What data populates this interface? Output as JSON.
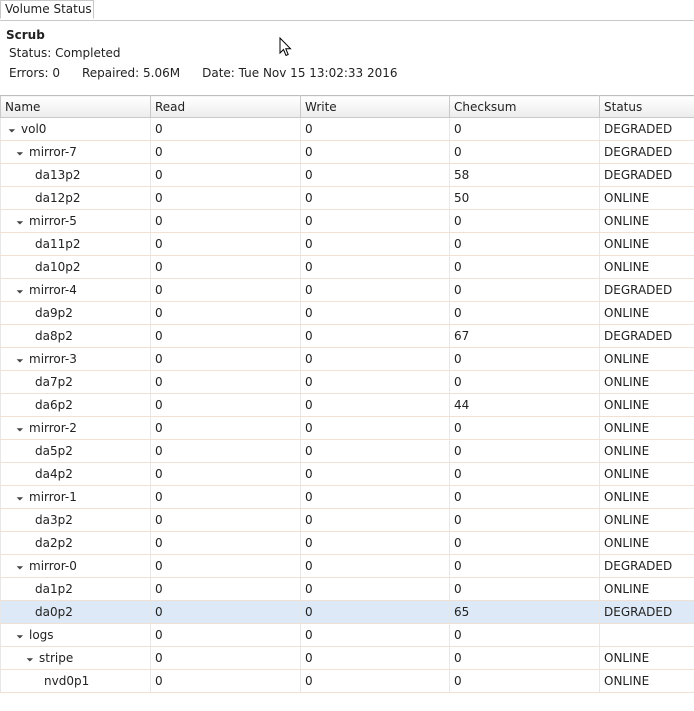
{
  "tab": {
    "label": "Volume Status"
  },
  "scrub": {
    "title": "Scrub",
    "status": "Status: Completed",
    "errors": "Errors: 0",
    "repaired": "Repaired: 5.06M",
    "date": "Date: Tue Nov 15 13:02:33 2016"
  },
  "table": {
    "columns": [
      "Name",
      "Read",
      "Write",
      "Checksum",
      "Status"
    ],
    "rows": [
      {
        "name": "vol0",
        "level": 0,
        "expander": true,
        "read": "0",
        "write": "0",
        "checksum": "0",
        "status": "DEGRADED"
      },
      {
        "name": "mirror-7",
        "level": 1,
        "expander": true,
        "read": "0",
        "write": "0",
        "checksum": "0",
        "status": "DEGRADED"
      },
      {
        "name": "da13p2",
        "level": 2,
        "expander": false,
        "read": "0",
        "write": "0",
        "checksum": "58",
        "status": "DEGRADED"
      },
      {
        "name": "da12p2",
        "level": 2,
        "expander": false,
        "read": "0",
        "write": "0",
        "checksum": "50",
        "status": "ONLINE"
      },
      {
        "name": "mirror-5",
        "level": 1,
        "expander": true,
        "read": "0",
        "write": "0",
        "checksum": "0",
        "status": "ONLINE"
      },
      {
        "name": "da11p2",
        "level": 2,
        "expander": false,
        "read": "0",
        "write": "0",
        "checksum": "0",
        "status": "ONLINE"
      },
      {
        "name": "da10p2",
        "level": 2,
        "expander": false,
        "read": "0",
        "write": "0",
        "checksum": "0",
        "status": "ONLINE"
      },
      {
        "name": "mirror-4",
        "level": 1,
        "expander": true,
        "read": "0",
        "write": "0",
        "checksum": "0",
        "status": "DEGRADED"
      },
      {
        "name": "da9p2",
        "level": 2,
        "expander": false,
        "read": "0",
        "write": "0",
        "checksum": "0",
        "status": "ONLINE"
      },
      {
        "name": "da8p2",
        "level": 2,
        "expander": false,
        "read": "0",
        "write": "0",
        "checksum": "67",
        "status": "DEGRADED"
      },
      {
        "name": "mirror-3",
        "level": 1,
        "expander": true,
        "read": "0",
        "write": "0",
        "checksum": "0",
        "status": "ONLINE"
      },
      {
        "name": "da7p2",
        "level": 2,
        "expander": false,
        "read": "0",
        "write": "0",
        "checksum": "0",
        "status": "ONLINE"
      },
      {
        "name": "da6p2",
        "level": 2,
        "expander": false,
        "read": "0",
        "write": "0",
        "checksum": "44",
        "status": "ONLINE"
      },
      {
        "name": "mirror-2",
        "level": 1,
        "expander": true,
        "read": "0",
        "write": "0",
        "checksum": "0",
        "status": "ONLINE"
      },
      {
        "name": "da5p2",
        "level": 2,
        "expander": false,
        "read": "0",
        "write": "0",
        "checksum": "0",
        "status": "ONLINE"
      },
      {
        "name": "da4p2",
        "level": 2,
        "expander": false,
        "read": "0",
        "write": "0",
        "checksum": "0",
        "status": "ONLINE"
      },
      {
        "name": "mirror-1",
        "level": 1,
        "expander": true,
        "read": "0",
        "write": "0",
        "checksum": "0",
        "status": "ONLINE"
      },
      {
        "name": "da3p2",
        "level": 2,
        "expander": false,
        "read": "0",
        "write": "0",
        "checksum": "0",
        "status": "ONLINE"
      },
      {
        "name": "da2p2",
        "level": 2,
        "expander": false,
        "read": "0",
        "write": "0",
        "checksum": "0",
        "status": "ONLINE"
      },
      {
        "name": "mirror-0",
        "level": 1,
        "expander": true,
        "read": "0",
        "write": "0",
        "checksum": "0",
        "status": "DEGRADED"
      },
      {
        "name": "da1p2",
        "level": 2,
        "expander": false,
        "read": "0",
        "write": "0",
        "checksum": "0",
        "status": "ONLINE"
      },
      {
        "name": "da0p2",
        "level": 2,
        "expander": false,
        "read": "0",
        "write": "0",
        "checksum": "65",
        "status": "DEGRADED",
        "selected": true
      },
      {
        "name": "logs",
        "level": 1,
        "expander": true,
        "read": "0",
        "write": "0",
        "checksum": "0",
        "status": ""
      },
      {
        "name": "stripe",
        "level": 2,
        "expander": true,
        "read": "0",
        "write": "0",
        "checksum": "0",
        "status": "ONLINE"
      },
      {
        "name": "nvd0p1",
        "level": 3,
        "expander": false,
        "read": "0",
        "write": "0",
        "checksum": "0",
        "status": "ONLINE"
      }
    ]
  },
  "icons": {
    "expander": "triangle-down-icon",
    "cursor": "mouse-pointer-icon"
  }
}
